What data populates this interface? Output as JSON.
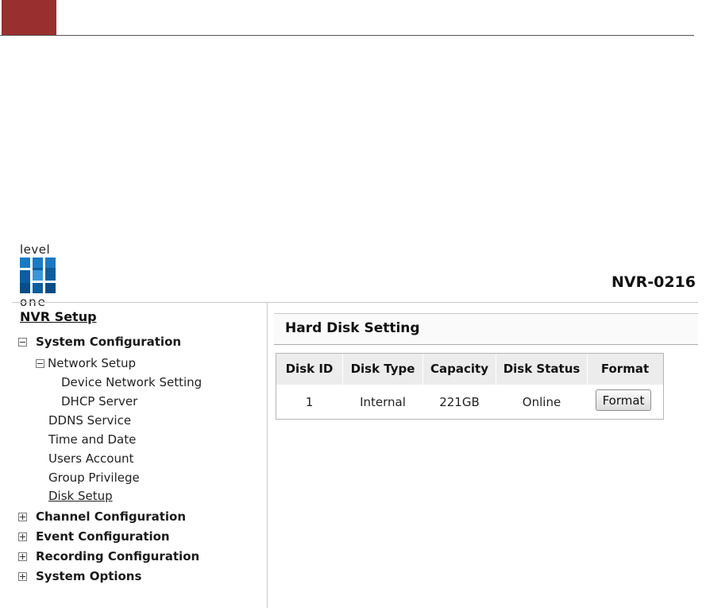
{
  "header": {
    "logo_top": "level",
    "logo_bottom": "one",
    "model": "NVR-0216",
    "accent_color": "#9a2f2f"
  },
  "sidebar": {
    "title": "NVR Setup",
    "system_configuration": "System Configuration",
    "network_setup": "Network Setup",
    "device_network_setting": "Device Network Setting",
    "dhcp_server": "DHCP Server",
    "ddns_service": "DDNS Service",
    "time_and_date": "Time and Date",
    "users_account": "Users Account",
    "group_privilege": "Group Privilege",
    "disk_setup": "Disk Setup",
    "channel_configuration": "Channel Configuration",
    "event_configuration": "Event Configuration",
    "recording_configuration": "Recording Configuration",
    "system_options": "System Options"
  },
  "main": {
    "title": "Hard Disk Setting",
    "table": {
      "headers": [
        "Disk ID",
        "Disk Type",
        "Capacity",
        "Disk Status",
        "Format"
      ],
      "rows": [
        {
          "disk_id": "1",
          "disk_type": "Internal",
          "capacity": "221GB",
          "status": "Online",
          "action": "Format"
        }
      ]
    }
  }
}
